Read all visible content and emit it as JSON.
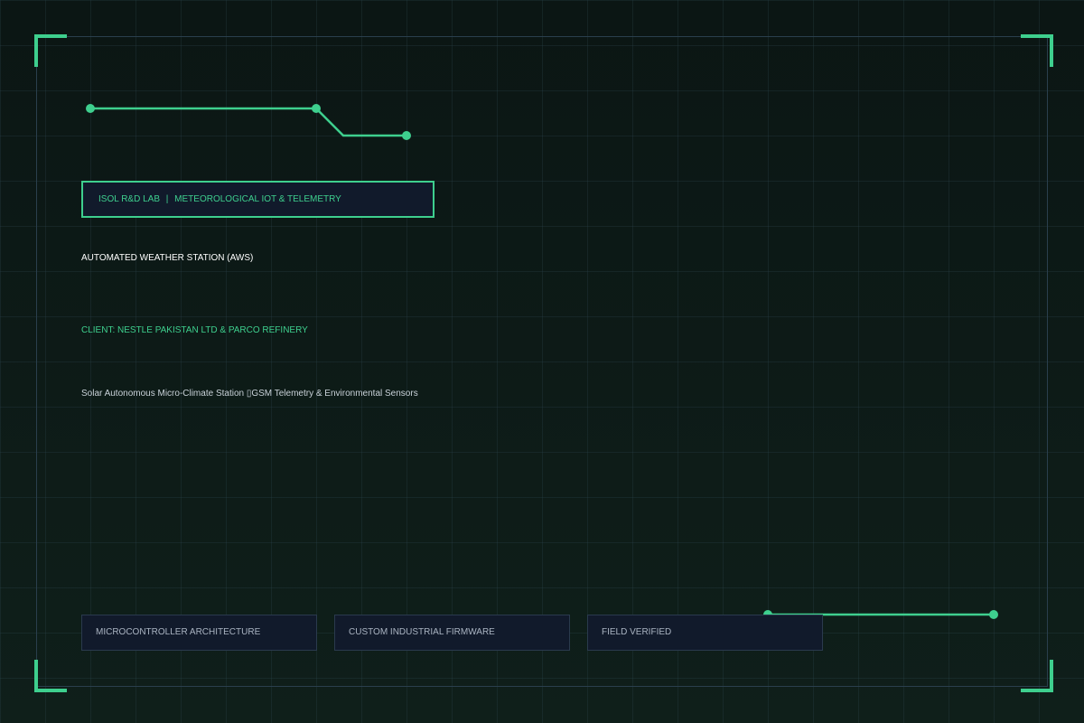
{
  "badge": {
    "lab": "ISOL R&D LAB",
    "separator": "|",
    "division": "METEOROLOGICAL IOT & TELEMETRY"
  },
  "title": "AUTOMATED WEATHER STATION (AWS)",
  "client": "CLIENT: NESTLE PAKISTAN LTD & PARCO REFINERY",
  "subtitle": "Solar Autonomous Micro-Climate Station ▯GSM Telemetry & Environmental Sensors",
  "tags": [
    {
      "label": "MICROCONTROLLER ARCHITECTURE"
    },
    {
      "label": "CUSTOM INDUSTRIAL FIRMWARE"
    },
    {
      "label": "FIELD VERIFIED"
    }
  ],
  "colors": {
    "accent": "#3ecf8e",
    "panel": "#111a2b",
    "frame": "#2a3f4d",
    "background": "#0b1714"
  }
}
